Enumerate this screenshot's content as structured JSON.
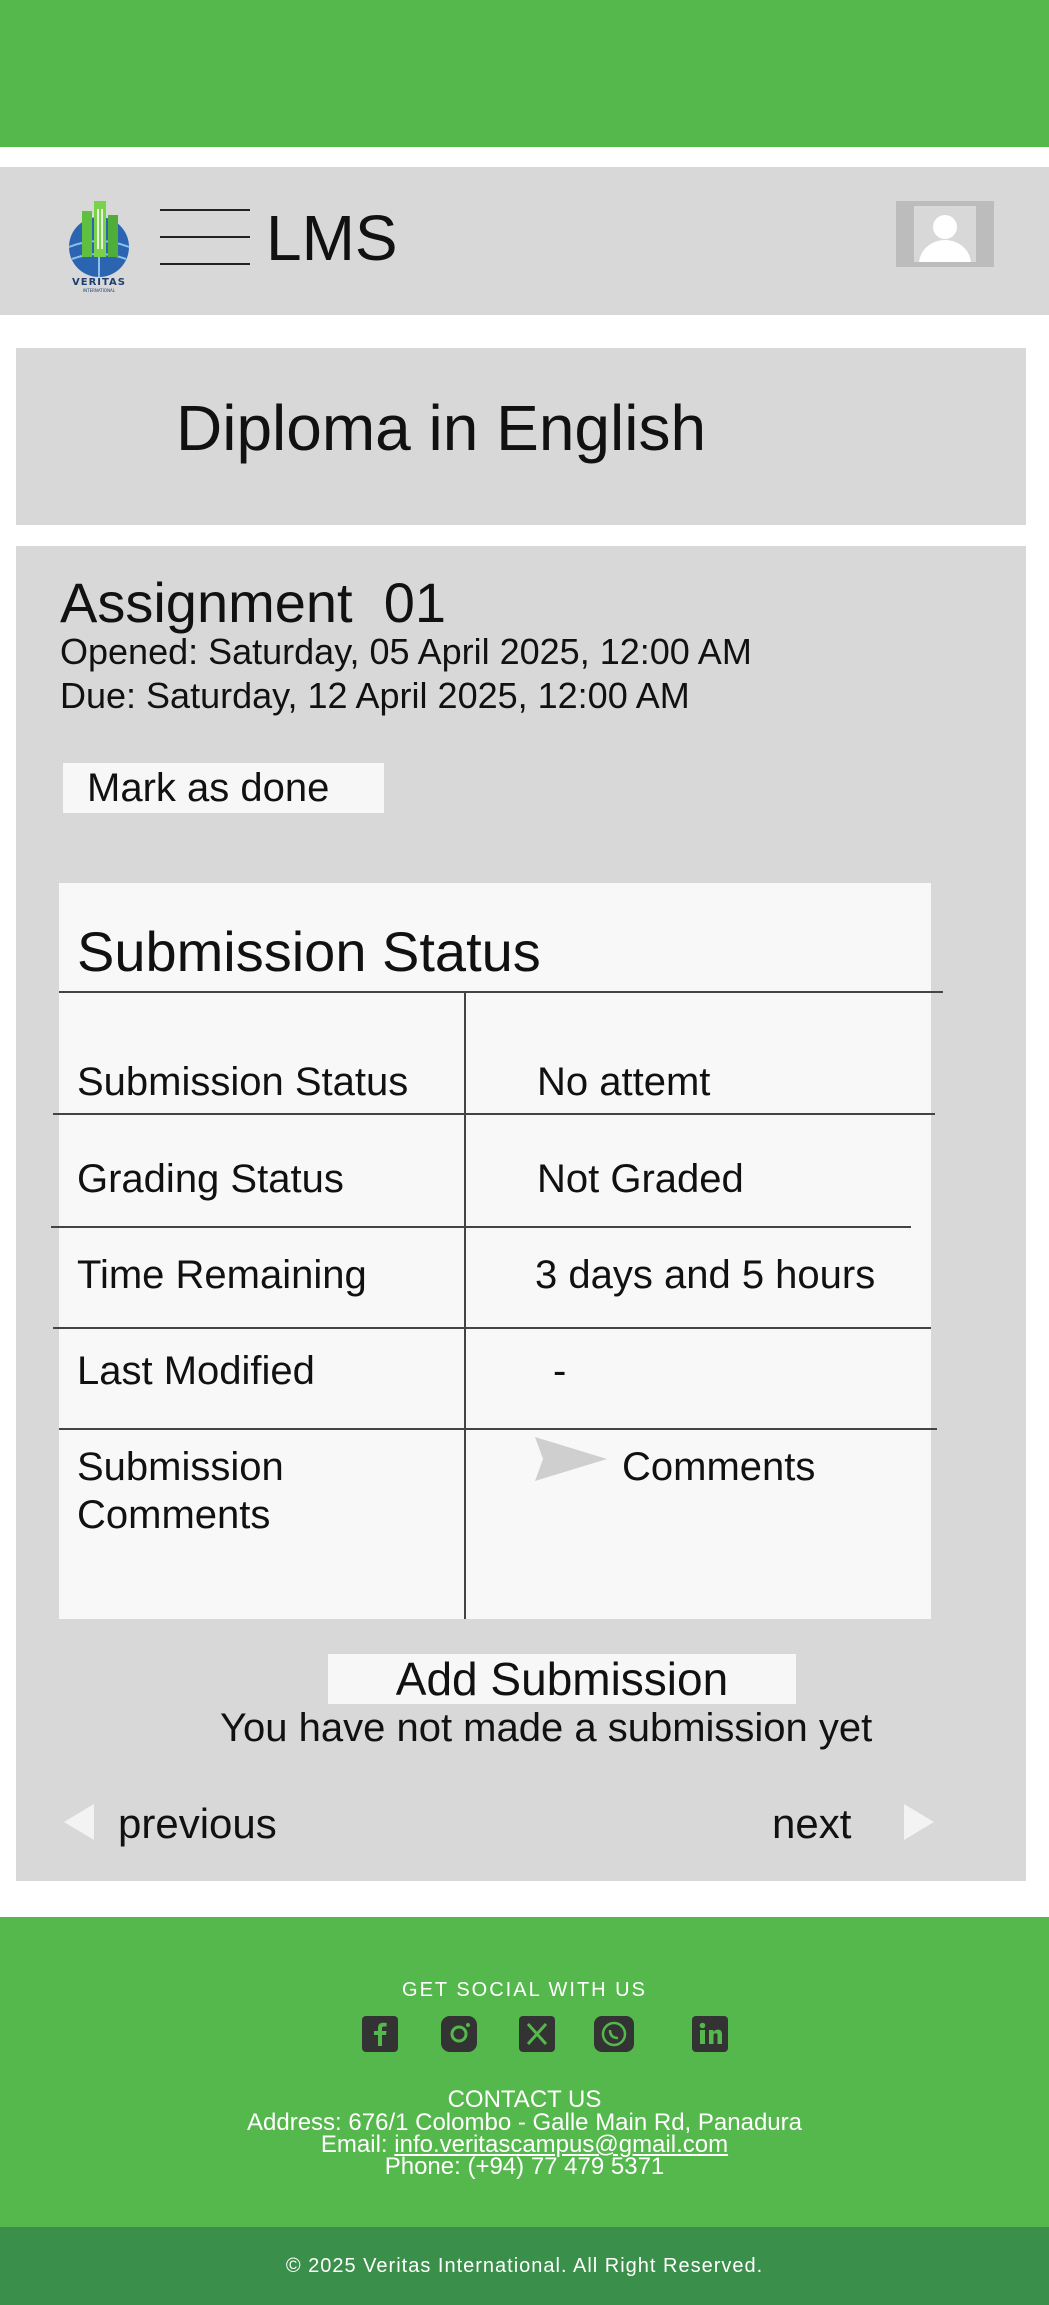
{
  "header": {
    "logo_text": "VERITAS",
    "logo_subtext": "INTERNATIONAL",
    "app_title": "LMS"
  },
  "course": {
    "title": "Diploma in English"
  },
  "assignment": {
    "title": "Assignment  01",
    "opened": "Opened: Saturday, 05 April 2025, 12:00 AM",
    "due": "Due: Saturday, 12 April 2025, 12:00 AM",
    "mark_done_label": "Mark as done"
  },
  "submission": {
    "heading": "Submission Status",
    "rows": [
      {
        "label": "Submission Status",
        "value": "No attemt"
      },
      {
        "label": "Grading Status",
        "value": "Not Graded"
      },
      {
        "label": "Time Remaining",
        "value": "3 days and 5 hours"
      },
      {
        "label": "Last Modified",
        "value": "-"
      },
      {
        "label": "Submission Comments",
        "value": "Comments"
      }
    ],
    "add_button_label": "Add Submission",
    "status_note": "You have not made a submission yet"
  },
  "navigation": {
    "previous_label": "previous",
    "next_label": "next"
  },
  "footer": {
    "social_heading": "GET SOCIAL WITH US",
    "social_icons": [
      "facebook-icon",
      "instagram-icon",
      "x-icon",
      "whatsapp-icon",
      "linkedin-icon"
    ],
    "contact_heading": "CONTACT US",
    "address": "Address: 676/1 Colombo - Galle Main Rd, Panadura",
    "email_prefix": "Email: ",
    "email": "info.veritascampus@gmail.com",
    "phone": "Phone: (+94) 77 479 5371",
    "copyright": "© 2025 Veritas International. All Right Reserved."
  },
  "colors": {
    "brand_green": "#55b84c",
    "dark_green": "#3a8f4a",
    "panel_gray": "#d8d8d8"
  }
}
